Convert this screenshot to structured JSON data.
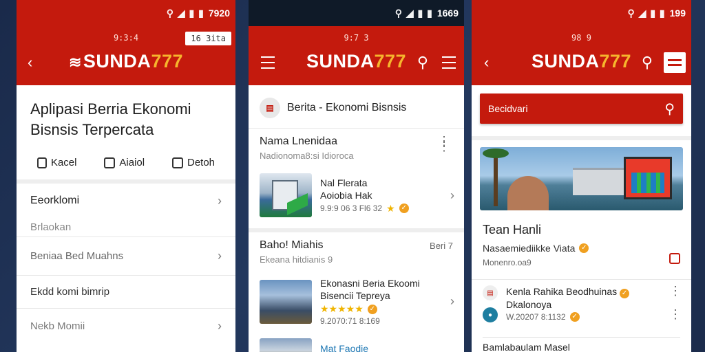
{
  "brand": {
    "main": "SUNDA",
    "accent": "777"
  },
  "colors": {
    "primary": "#c41a0d",
    "accent": "#f6b52d"
  },
  "phone1": {
    "status_time": "7920",
    "clock": "9:3:4",
    "chip": "16 3ita",
    "title_line1": "Aplipasi Berria Ekonomi",
    "title_line2": "Bisnsis Terpercata",
    "actions": [
      "Kacel",
      "Aiaiol",
      "Detoh"
    ],
    "rows": [
      "Eeorklomi",
      "Brlaokan",
      "Beniaa Bed Muahns",
      "Ekdd komi bimrip",
      "Nekb Momii"
    ]
  },
  "phone2": {
    "status_time": "1669",
    "clock": "9:7 3",
    "header": "Berita - Ekonomi Bisnsis",
    "section1": {
      "title": "Nama Lnenidaa",
      "subtitle": "Nadionoma8:si Idioroca"
    },
    "card1": {
      "line1": "Nal Flerata",
      "line2": "Aoiobia Hak",
      "meta": "9.9:9 06 3 Fl6 32"
    },
    "section2": {
      "title": "Baho! Miahis",
      "subtitle": "Ekeana hitdianis 9",
      "right": "Beri 7"
    },
    "card2": {
      "line1": "Ekonasni Beria Ekoomi",
      "line2": "Bisencii Tepreya",
      "meta": "9.2070:71 8:169"
    },
    "bottom_link": "Mat Faodie"
  },
  "phone3": {
    "status_time": "199",
    "clock": "98 9",
    "search_placeholder": "Becidvari",
    "title": "Tean Hanli",
    "line": "Nasaemiediikke Viata",
    "sub": "Monenro.oa9",
    "card": {
      "line1": "Kenla Rahika Beodhuinas",
      "line2": "Dkalonoya",
      "meta": "W.20207 8:1132"
    },
    "bottom": "Bamlabaulam Masel"
  }
}
